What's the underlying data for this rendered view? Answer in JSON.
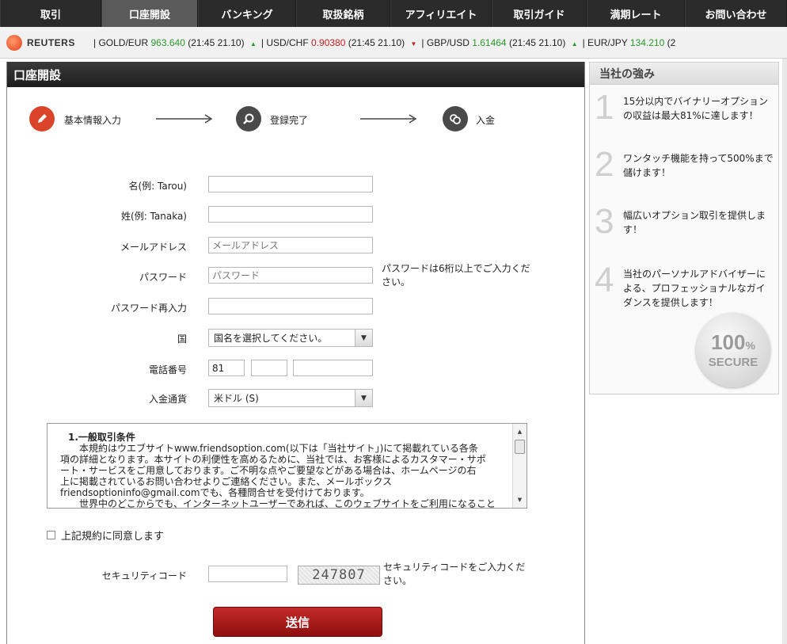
{
  "nav": {
    "items": [
      {
        "label": "取引"
      },
      {
        "label": "口座開設"
      },
      {
        "label": "バンキング"
      },
      {
        "label": "取扱銘柄"
      },
      {
        "label": "アフィリエイト"
      },
      {
        "label": "取引ガイド"
      },
      {
        "label": "満期レート"
      },
      {
        "label": "お問い合わせ"
      }
    ]
  },
  "ticker": {
    "brand": "REUTERS",
    "items": [
      {
        "pair": "| GOLD/EUR",
        "value": "963.640",
        "time": "(21:45 21.10)"
      },
      {
        "pair": "| USD/CHF",
        "value": "0.90380",
        "time": "(21:45 21.10)"
      },
      {
        "pair": "| GBP/USD",
        "value": "1.61464",
        "time": "(21:45 21.10)"
      },
      {
        "pair": "| EUR/JPY",
        "value": "134.210",
        "time": "(2"
      }
    ]
  },
  "main": {
    "title": "口座開設",
    "steps": [
      "基本情報入力",
      "登録完了",
      "入金"
    ],
    "form": {
      "first_name_label": "名(例: Tarou)",
      "last_name_label": "姓(例: Tanaka)",
      "email_label": "メールアドレス",
      "email_placeholder": "メールアドレス",
      "password_label": "パスワード",
      "password_placeholder": "パスワード",
      "password_hint": "パスワードは6桁以上でご入力ください。",
      "password_confirm_label": "パスワード再入力",
      "country_label": "国",
      "country_value": "国名を選択してください。",
      "phone_label": "電話番号",
      "phone_code": "81",
      "currency_label": "入金通貨",
      "currency_value": "米ドル (S)",
      "security_label": "セキュリティコード",
      "security_code": "247807",
      "security_hint": "セキュリティコードをご入力ください。",
      "submit_label": "送信"
    },
    "terms": {
      "title": "1.一般取引条件",
      "lines": [
        "本規約はウエブサイトwww.friendsoption.com(以下は「当社サイト」)にて掲載れている各条",
        "項の詳細となります。本サイトの利便性を高めるために、当社では、お客様によるカスタマー・サポ",
        "ート・サービスをご用意しております。ご不明な点やご要望などがある場合は、ホームページの右",
        "上に掲載されているお問い合わせよりご連絡ください。また、メールボックス",
        "friendsoptioninfo@gmail.comでも、各種問合せを受付けております。",
        "世界中のどこからでも、インターネットユーザーであれば、このウェブサイトをご利用になること"
      ]
    },
    "agree_label": "上記規約に同意します"
  },
  "sidebar": {
    "title": "当社の強み",
    "items": [
      {
        "num": "1",
        "text": "15分以内でバイナリーオプションの収益は最大81%に達します！"
      },
      {
        "num": "2",
        "text": "ワンタッチ機能を持って500%まで儲けます！"
      },
      {
        "num": "3",
        "text": "幅広いオプション取引を提供します！"
      },
      {
        "num": "4",
        "text": "当社のパーソナルアドバイザーによる、プロフェッショナルなガイダンスを提供します！"
      }
    ],
    "badge_pct": "100",
    "badge_pct_unit": "%",
    "badge_word": "SECURE"
  }
}
